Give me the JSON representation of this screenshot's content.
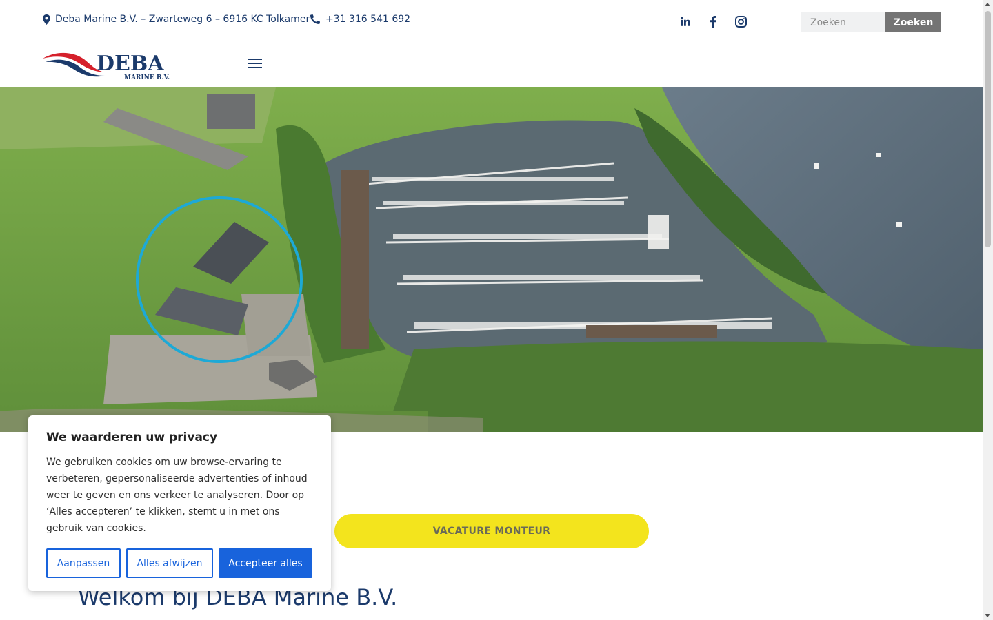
{
  "topbar": {
    "address": "Deba Marine B.V. – Zwarteweg 6 – 6916 KC Tolkamer",
    "address_icon": "map-pin-icon",
    "phone": "+31 316 541 692",
    "phone_icon": "phone-icon",
    "social": [
      "linkedin-icon",
      "facebook-icon",
      "instagram-icon"
    ],
    "search": {
      "placeholder": "Zoeken",
      "button_label": "Zoeken"
    }
  },
  "header": {
    "logo_text": "DEBA",
    "logo_subtext": "MARINE B.V.",
    "menu_icon": "hamburger-menu-icon"
  },
  "hero": {
    "image": "aerial view of marina with highlighted building",
    "highlight_color": "#1da9d6"
  },
  "cta": {
    "label": "VACATURE MONTEUR",
    "color": "#f3e41d"
  },
  "main": {
    "welcome_title": "Welkom bij DEBA Marine B.V."
  },
  "cookie_banner": {
    "title": "We waarderen uw privacy",
    "text": "We gebruiken cookies om uw browse-ervaring te verbeteren, gepersonaliseerde advertenties of inhoud weer te geven en ons verkeer te analyseren. Door op ‘Alles accepteren’ te klikken, stemt u in met ons gebruik van cookies.",
    "customize_label": "Aanpassen",
    "reject_label": "Alles afwijzen",
    "accept_label": "Accepteer alles",
    "accent_color": "#1863dc"
  },
  "colors": {
    "brand_navy": "#1b3a6b",
    "brand_red": "#d5202b"
  }
}
